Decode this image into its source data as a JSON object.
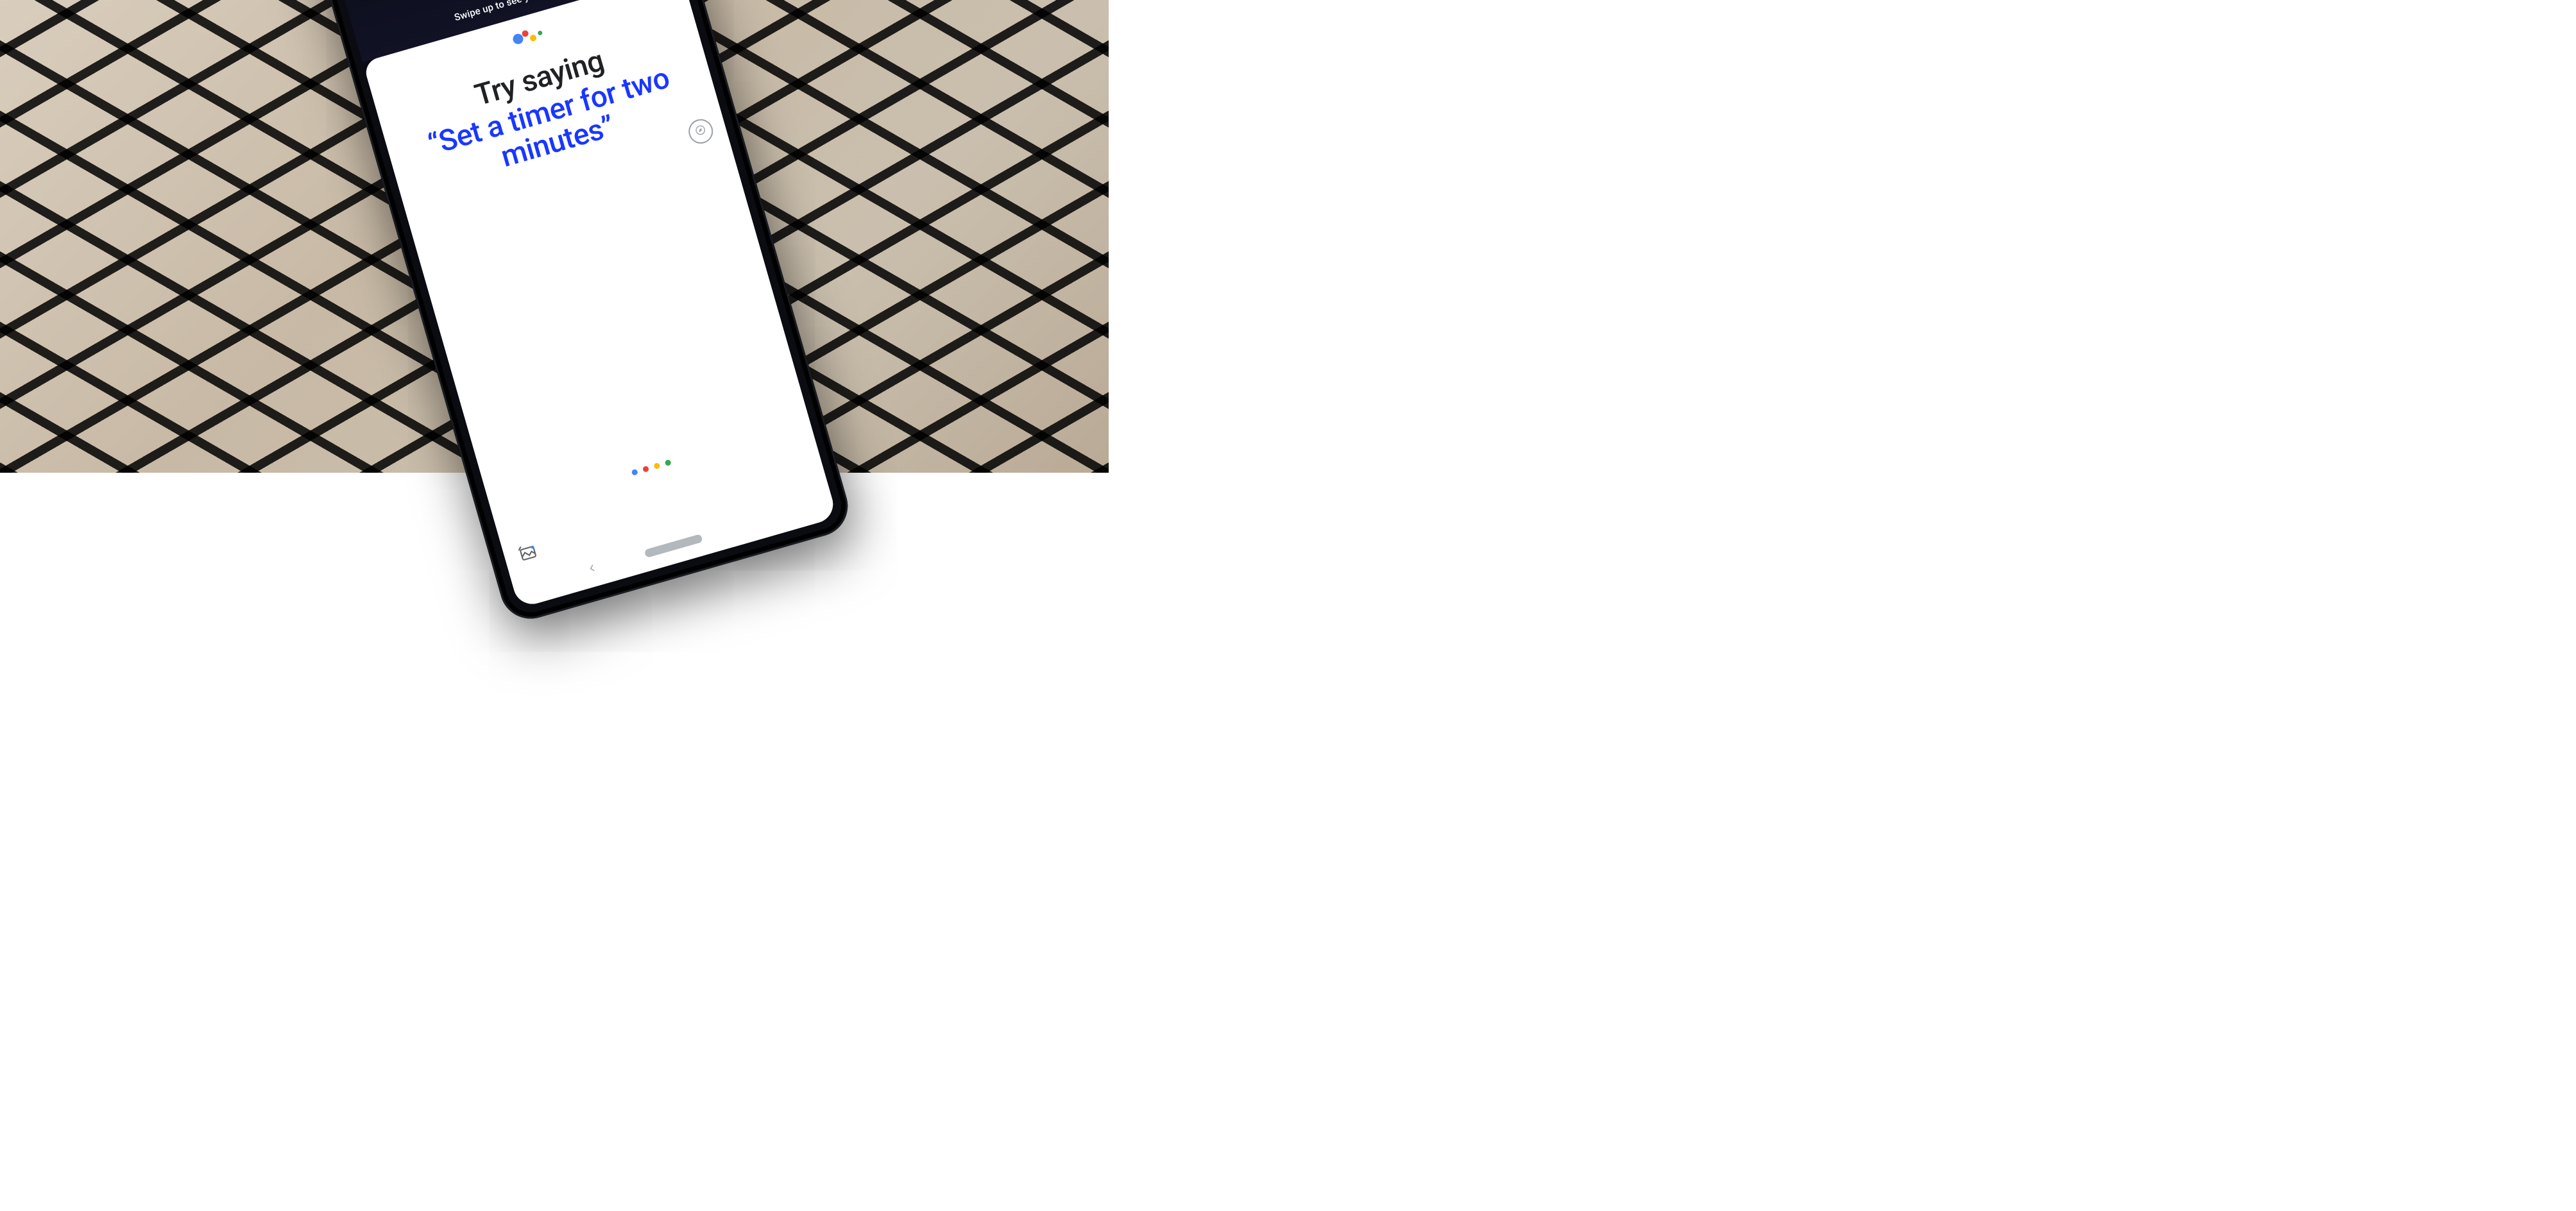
{
  "hint": "Swipe up to see your updates",
  "prompt": {
    "lead": "Try saying",
    "command": "“Set a timer for two minutes”"
  },
  "logo_colors": {
    "blue": "#4285F4",
    "red": "#EA4335",
    "yellow": "#FBBC05",
    "green": "#34A853"
  }
}
